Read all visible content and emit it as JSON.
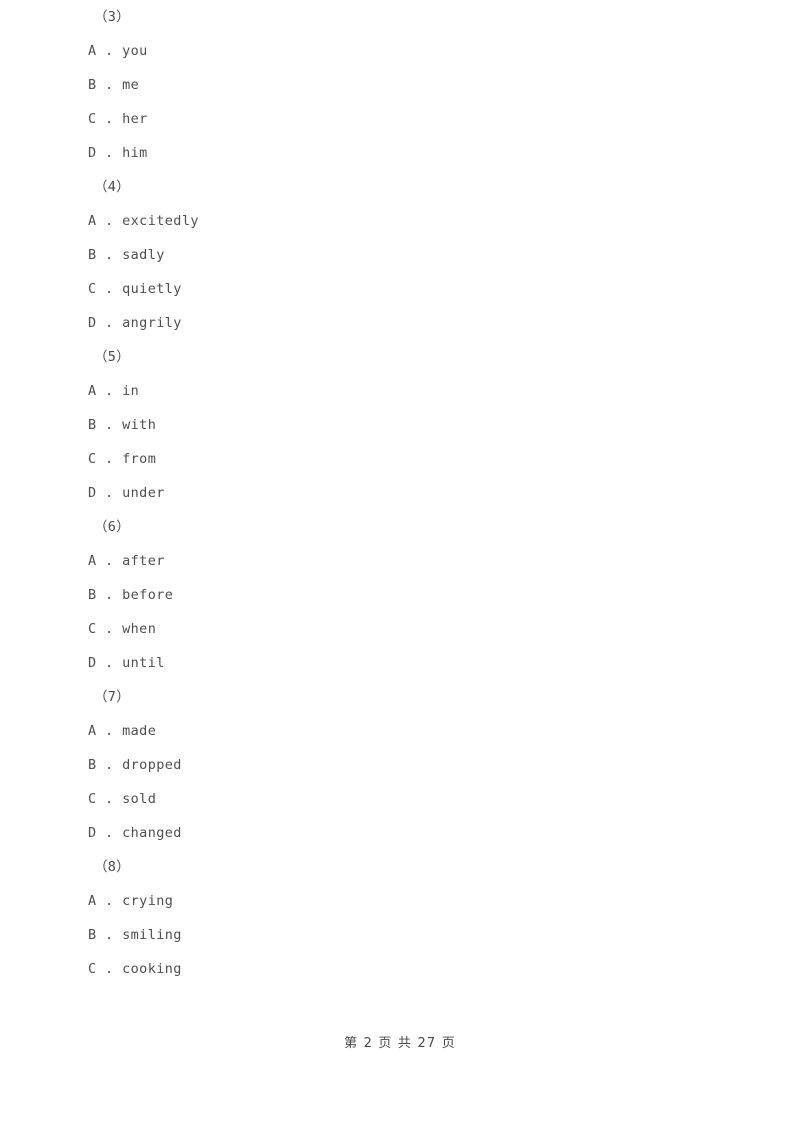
{
  "document": {
    "page_background": "#ffffff",
    "text_color": "#4f4f4f"
  },
  "question_groups": [
    {
      "number_label": "（3）",
      "options": [
        {
          "letter": "A",
          "separator": " . ",
          "text": "you"
        },
        {
          "letter": "B",
          "separator": " . ",
          "text": "me"
        },
        {
          "letter": "C",
          "separator": " . ",
          "text": "her"
        },
        {
          "letter": "D",
          "separator": " . ",
          "text": "him"
        }
      ]
    },
    {
      "number_label": "（4）",
      "options": [
        {
          "letter": "A",
          "separator": " . ",
          "text": "excitedly"
        },
        {
          "letter": "B",
          "separator": " . ",
          "text": "sadly"
        },
        {
          "letter": "C",
          "separator": " . ",
          "text": "quietly"
        },
        {
          "letter": "D",
          "separator": " . ",
          "text": "angrily"
        }
      ]
    },
    {
      "number_label": "（5）",
      "options": [
        {
          "letter": "A",
          "separator": " . ",
          "text": "in"
        },
        {
          "letter": "B",
          "separator": " . ",
          "text": "with"
        },
        {
          "letter": "C",
          "separator": " . ",
          "text": "from"
        },
        {
          "letter": "D",
          "separator": " . ",
          "text": "under"
        }
      ]
    },
    {
      "number_label": "（6）",
      "options": [
        {
          "letter": "A",
          "separator": " . ",
          "text": "after"
        },
        {
          "letter": "B",
          "separator": " . ",
          "text": "before"
        },
        {
          "letter": "C",
          "separator": " . ",
          "text": "when"
        },
        {
          "letter": "D",
          "separator": " . ",
          "text": "until"
        }
      ]
    },
    {
      "number_label": "（7）",
      "options": [
        {
          "letter": "A",
          "separator": " . ",
          "text": "made"
        },
        {
          "letter": "B",
          "separator": " . ",
          "text": "dropped"
        },
        {
          "letter": "C",
          "separator": " . ",
          "text": "sold"
        },
        {
          "letter": "D",
          "separator": " . ",
          "text": "changed"
        }
      ]
    },
    {
      "number_label": "（8）",
      "options": [
        {
          "letter": "A",
          "separator": " . ",
          "text": "crying"
        },
        {
          "letter": "B",
          "separator": " . ",
          "text": "smiling"
        },
        {
          "letter": "C",
          "separator": " . ",
          "text": "cooking"
        }
      ]
    }
  ],
  "footer": {
    "text": "第 2 页 共 27 页",
    "current_page": "2",
    "total_pages": "27"
  }
}
